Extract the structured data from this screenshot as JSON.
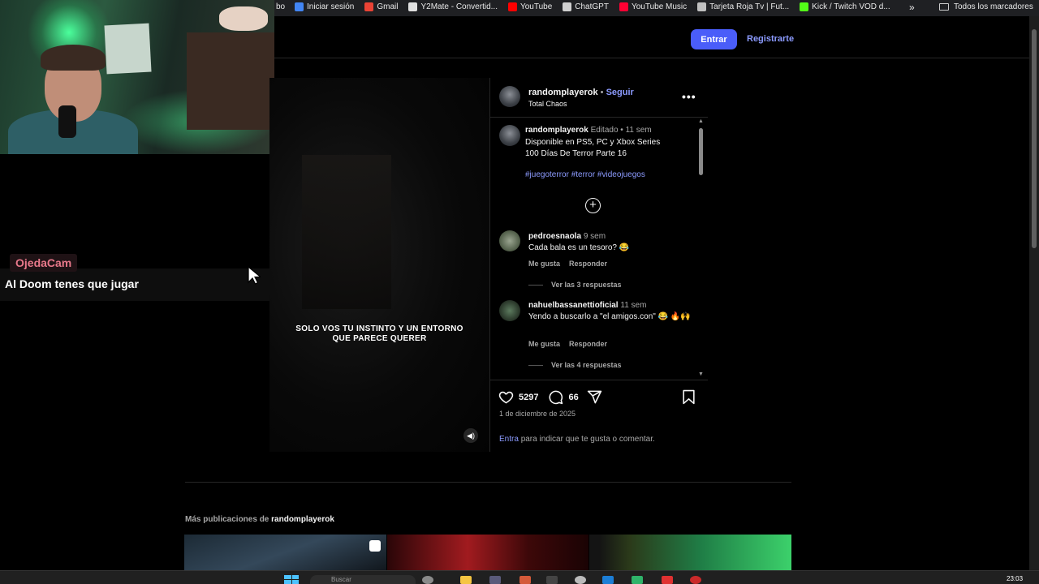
{
  "bookmarks": {
    "first": "bo",
    "items": [
      {
        "label": "Iniciar sesión",
        "color": "#4285f4"
      },
      {
        "label": "Gmail",
        "color": "#ea4335"
      },
      {
        "label": "Y2Mate - Convertid...",
        "color": "#e0e0e0"
      },
      {
        "label": "YouTube",
        "color": "#ff0000"
      },
      {
        "label": "ChatGPT",
        "color": "#d0d0d0"
      },
      {
        "label": "YouTube Music",
        "color": "#ff0033"
      },
      {
        "label": "Tarjeta Roja Tv | Fut...",
        "color": "#c0c0c0"
      },
      {
        "label": "Kick / Twitch VOD d...",
        "color": "#53fc18"
      }
    ],
    "more": "»",
    "all_bookmarks": "Todos los marcadores"
  },
  "chat": {
    "username": "OjedaCam",
    "message": "Al Doom tenes que jugar"
  },
  "header": {
    "login_button": "Entrar",
    "signup_link": "Registrarte"
  },
  "video": {
    "overlay_text": "SOLO VOS TU INSTINTO Y UN ENTORNO QUE PARECE QUERER"
  },
  "post": {
    "author": "randomplayerok",
    "separator": "•",
    "follow": "Seguir",
    "audio": "Total Chaos",
    "caption_user": "randomplayerok",
    "caption_meta": "Editado • 11 sem",
    "caption_line1": "Disponible en PS5, PC y Xbox Series",
    "caption_line2": "100 Días De Terror Parte 16",
    "hashtags": "#juegoterror #terror #videojuegos",
    "likes": "5297",
    "comments_count": "66",
    "date": "1 de diciembre de 2025",
    "login_link": "Entra",
    "login_text": "para indicar que te gusta o comentar."
  },
  "comments": [
    {
      "user": "pedroesnaola",
      "time": "9 sem",
      "text": "Cada bala es un tesoro? 😂",
      "like": "Me gusta",
      "reply": "Responder",
      "replies": "Ver las 3 respuestas"
    },
    {
      "user": "nahuelbassanettioficial",
      "time": "11 sem",
      "text": "Yendo a buscarlo a \"el amigos.con\" 😂 🔥🙌",
      "like": "Me gusta",
      "reply": "Responder",
      "replies": "Ver las 4 respuestas"
    }
  ],
  "more_posts": {
    "prefix": "Más publicaciones de",
    "user": "randomplayerok"
  },
  "taskbar": {
    "search_placeholder": "Buscar",
    "clock": "23:03"
  }
}
